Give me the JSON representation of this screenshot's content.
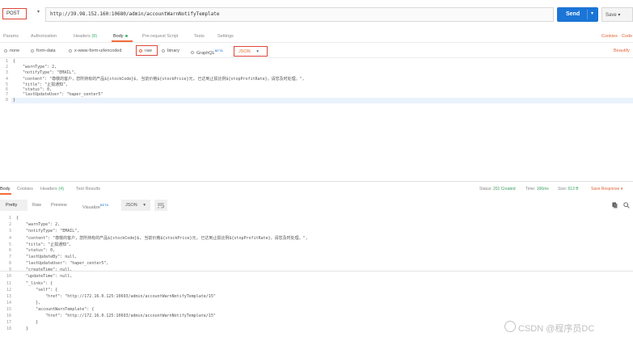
{
  "request": {
    "method": "POST",
    "url": "http://39.98.152.160:10680/admin/accountWarnNotifyTemplate",
    "send_label": "Send",
    "save_label": "Save"
  },
  "tabs": {
    "params": "Params",
    "authorization": "Authorization",
    "headers": "Headers",
    "headers_count": "(8)",
    "body": "Body",
    "prerequest": "Pre-request Script",
    "tests": "Tests",
    "settings": "Settings",
    "cookies": "Cookies",
    "code": "Code"
  },
  "body_options": {
    "none": "none",
    "form_data": "form-data",
    "urlencoded": "x-www-form-urlencoded",
    "raw": "raw",
    "binary": "binary",
    "graphql": "GraphQL",
    "graphql_badge": "BETA",
    "format": "JSON",
    "beautify": "Beautify"
  },
  "request_body": [
    {
      "n": "1",
      "text": "{"
    },
    {
      "n": "2",
      "text": "    \"warnType\": 2,"
    },
    {
      "n": "3",
      "text": "    \"notifyType\": \"EMAIL\","
    },
    {
      "n": "4",
      "text": "    \"content\": \"尊敬的客户，您所持有的产品${stockCode}$, 当前价格${stockPrice}元, 已达到止损比例${stopProfitRate}，请您及时处理。\","
    },
    {
      "n": "5",
      "text": "    \"title\": \"止损通知\","
    },
    {
      "n": "6",
      "text": "    \"status\": 0,"
    },
    {
      "n": "7",
      "text": "    \"lastUpdateUser\": \"haper_center5\""
    },
    {
      "n": "8",
      "text": "}"
    }
  ],
  "response_tabs": {
    "body": "Body",
    "cookies": "Cookies",
    "headers": "Headers",
    "headers_count": "(4)",
    "test_results": "Test Results"
  },
  "response_status": {
    "status_label": "Status:",
    "status_value": "201 Created",
    "time_label": "Time:",
    "time_value": "166ms",
    "size_label": "Size:",
    "size_value": "613 B",
    "save_response": "Save Response"
  },
  "response_view": {
    "pretty": "Pretty",
    "raw": "Raw",
    "preview": "Preview",
    "visualize": "Visualize",
    "visualize_badge": "BETA",
    "format": "JSON"
  },
  "response_body": [
    {
      "n": "1",
      "text": "{"
    },
    {
      "n": "2",
      "text": "    \"warnType\": 2,"
    },
    {
      "n": "3",
      "text": "    \"notifyType\": \"EMAIL\","
    },
    {
      "n": "4",
      "text": "    \"content\": \"尊敬的客户，您所持有的产品${stockCode}$, 当前价格${stockPrice}元, 已达到止损比例${stopProfitRate}，请您及时处理。\","
    },
    {
      "n": "5",
      "text": "    \"title\": \"止损通知\","
    },
    {
      "n": "6",
      "text": "    \"status\": 0,"
    },
    {
      "n": "7",
      "text": "    \"lastUpdateBy\": null,"
    },
    {
      "n": "8",
      "text": "    \"lastUpdateUser\": \"haper_center5\","
    },
    {
      "n": "9",
      "text": "    \"createTime\": null,"
    },
    {
      "n": "10",
      "text": "    \"updateTime\": null,"
    },
    {
      "n": "11",
      "text": "    \"_links\": {"
    },
    {
      "n": "12",
      "text": "        \"self\": {"
    },
    {
      "n": "13",
      "text": "            \"href\": \"http://172.16.0.125:10693/admin/accountWarnNotifyTemplate/15\""
    },
    {
      "n": "14",
      "text": "        },"
    },
    {
      "n": "15",
      "text": "        \"accountWarnTemplate\": {"
    },
    {
      "n": "16",
      "text": "            \"href\": \"http://172.16.0.125:10693/admin/accountWarnNotifyTemplate/15\""
    },
    {
      "n": "17",
      "text": "        }"
    },
    {
      "n": "18",
      "text": "    }"
    }
  ],
  "watermark": "CSDN @程序员DC"
}
